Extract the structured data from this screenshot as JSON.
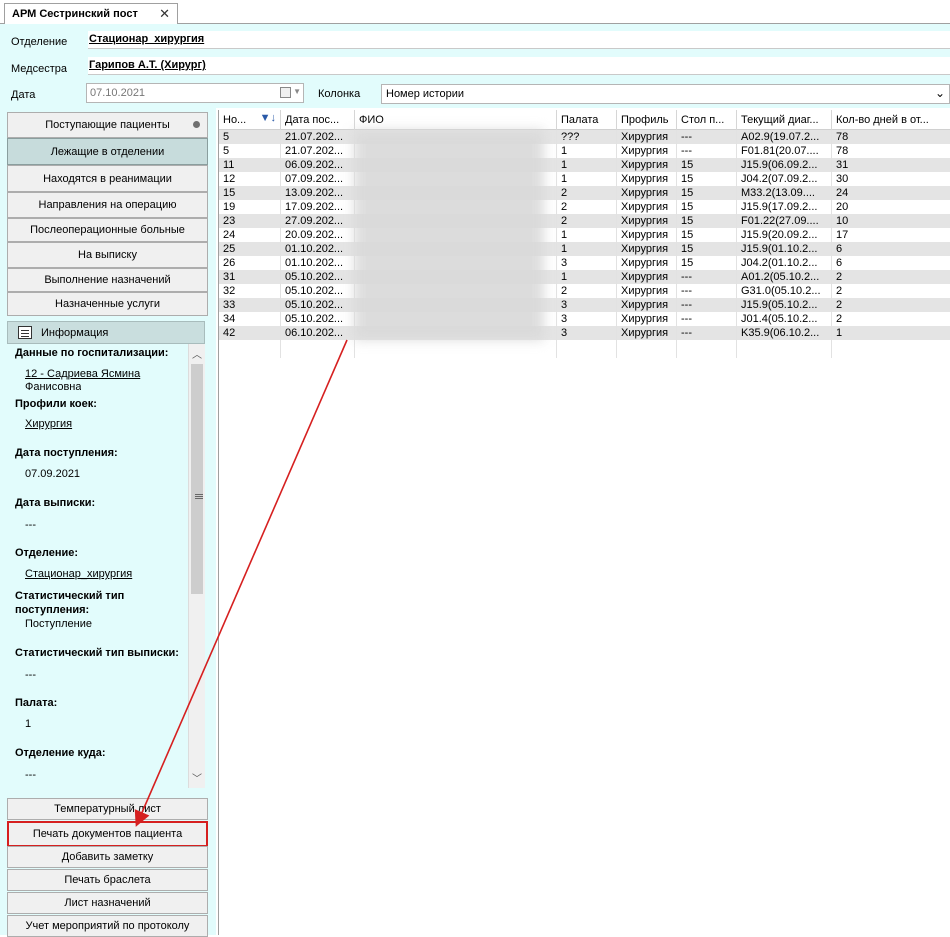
{
  "tab": {
    "title": "АРМ Сестринский пост",
    "close": "✕"
  },
  "header": {
    "department_label": "Отделение",
    "department_value": "Стационар_хирургия",
    "nurse_label": "Медсестра",
    "nurse_value": "Гарипов А.Т. (Хирург)",
    "date_label": "Дата",
    "date_value": "07.10.2021",
    "column_label": "Колонка",
    "column_value": "Номер истории"
  },
  "nav": [
    "Поступающие пациенты",
    "Лежащие в отделении",
    "Находятся в реанимации",
    "Направления на операцию",
    "Послеоперационные больные",
    "На выписку",
    "Выполнение назначений",
    "Назначенные услуги"
  ],
  "info": {
    "title": "Информация",
    "hosp_label": "Данные по госпитализации:",
    "hosp_value": "12 - Садриева Ясмина",
    "hosp_value2": "Фанисовна",
    "profile_label": "Профили коек:",
    "profile_value": "Хирургия",
    "admit_label": "Дата поступления:",
    "admit_value": "07.09.2021",
    "discharge_label": "Дата выписки:",
    "discharge_value": "---",
    "dept_label": "Отделение:",
    "dept_value": "Стационар_хирургия",
    "stat_in_label1": "Статистический тип",
    "stat_in_label2": "поступления:",
    "stat_in_value": "Поступление",
    "stat_out_label": "Статистический тип выписки:",
    "stat_out_value": "---",
    "ward_label": "Палата:",
    "ward_value": "1",
    "dept_to_label": "Отделение куда:",
    "dept_to_value": "---"
  },
  "actions": [
    "Температурный лист",
    "Печать документов пациента",
    "Добавить заметку",
    "Печать браслета",
    "Лист назначений",
    "Учет мероприятий по протоколу"
  ],
  "table": {
    "columns": [
      "Но...",
      "Дата пос...",
      "ФИО",
      "Палата",
      "Профиль",
      "Стол п...",
      "Текущий диаг...",
      "Кол-во дней в от..."
    ],
    "rows": [
      [
        "5",
        "21.07.202...",
        "",
        "???",
        "Хирургия",
        "---",
        "A02.9(19.07.2...",
        "78"
      ],
      [
        "5",
        "21.07.202...",
        "",
        "1",
        "Хирургия",
        "---",
        "F01.81(20.07....",
        "78"
      ],
      [
        "11",
        "06.09.202...",
        "",
        "1",
        "Хирургия",
        "15",
        "J15.9(06.09.2...",
        "31"
      ],
      [
        "12",
        "07.09.202...",
        "",
        "1",
        "Хирургия",
        "15",
        "J04.2(07.09.2...",
        "30"
      ],
      [
        "15",
        "13.09.202...",
        "",
        "2",
        "Хирургия",
        "15",
        "M33.2(13.09....",
        "24"
      ],
      [
        "19",
        "17.09.202...",
        "",
        "2",
        "Хирургия",
        "15",
        "J15.9(17.09.2...",
        "20"
      ],
      [
        "23",
        "27.09.202...",
        "",
        "2",
        "Хирургия",
        "15",
        "F01.22(27.09....",
        "10"
      ],
      [
        "24",
        "20.09.202...",
        "",
        "1",
        "Хирургия",
        "15",
        "J15.9(20.09.2...",
        "17"
      ],
      [
        "25",
        "01.10.202...",
        "",
        "1",
        "Хирургия",
        "15",
        "J15.9(01.10.2...",
        "6"
      ],
      [
        "26",
        "01.10.202...",
        "",
        "3",
        "Хирургия",
        "15",
        "J04.2(01.10.2...",
        "6"
      ],
      [
        "31",
        "05.10.202...",
        "",
        "1",
        "Хирургия",
        "---",
        "A01.2(05.10.2...",
        "2"
      ],
      [
        "32",
        "05.10.202...",
        "",
        "2",
        "Хирургия",
        "---",
        "G31.0(05.10.2...",
        "2"
      ],
      [
        "33",
        "05.10.202...",
        "",
        "3",
        "Хирургия",
        "---",
        "J15.9(05.10.2...",
        "2"
      ],
      [
        "34",
        "05.10.202...",
        "",
        "3",
        "Хирургия",
        "---",
        "J01.4(05.10.2...",
        "2"
      ],
      [
        "42",
        "06.10.202...",
        "",
        "3",
        "Хирургия",
        "---",
        "K35.9(06.10.2...",
        "1"
      ]
    ]
  },
  "colors": {
    "panel_bg": "#e2fcfc",
    "highlight_border": "#d62020",
    "arrow": "#d62020"
  }
}
